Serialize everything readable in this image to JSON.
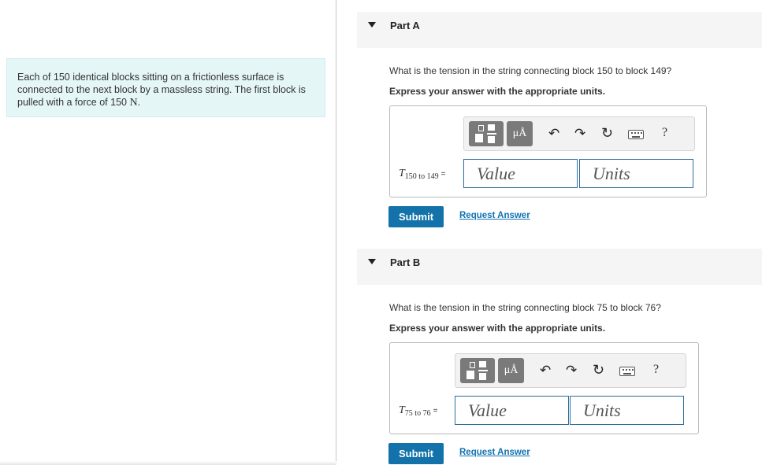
{
  "problem": {
    "text_before": "Each of 150 identical blocks sitting on a frictionless surface is connected to the next block by a massless string. The first block is pulled with a force of 150 ",
    "unit": "N",
    "text_after": "."
  },
  "parts": [
    {
      "title": "Part A",
      "question": "What is the tension in the string connecting block 150 to block 149?",
      "express": "Express your answer with the appropriate units.",
      "toolbar": {
        "units_button": "μÅ",
        "help": "?"
      },
      "variable": {
        "symbol": "T",
        "subscript": "150 to 149",
        "equals": "="
      },
      "value_placeholder": "Value",
      "units_placeholder": "Units",
      "submit_label": "Submit",
      "request_label": "Request Answer"
    },
    {
      "title": "Part B",
      "question": "What is the tension in the string connecting block 75 to block 76?",
      "express": "Express your answer with the appropriate units.",
      "toolbar": {
        "units_button": "μÅ",
        "help": "?"
      },
      "variable": {
        "symbol": "T",
        "subscript": "75 to 76",
        "equals": "="
      },
      "value_placeholder": "Value",
      "units_placeholder": "Units",
      "submit_label": "Submit",
      "request_label": "Request Answer"
    }
  ],
  "icons": {
    "undo": "undo-icon",
    "redo": "redo-icon",
    "reset": "reset-icon",
    "keyboard": "keyboard-icon",
    "templates": "templates-icon",
    "collapse": "collapse-triangle-icon"
  },
  "colors": {
    "problem_bg": "#e5f6f7",
    "submit_bg": "#1272a9",
    "link": "#1072b3",
    "input_border": "#2b6e99"
  }
}
